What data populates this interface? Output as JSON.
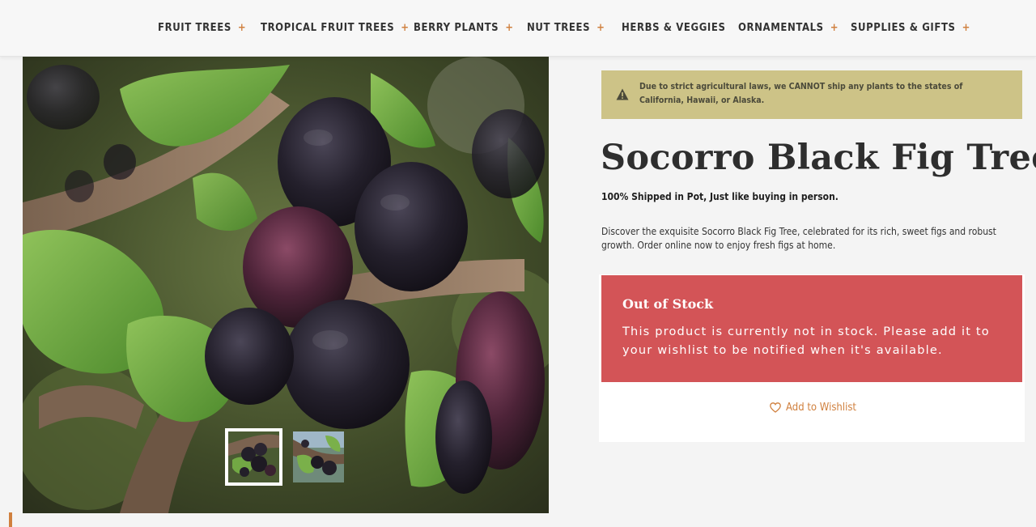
{
  "nav": {
    "items": [
      {
        "label": "FRUIT TREES",
        "has_submenu": true
      },
      {
        "label": "TROPICAL FRUIT TREES",
        "has_submenu": true
      },
      {
        "label": "BERRY PLANTS",
        "has_submenu": true
      },
      {
        "label": "NUT TREES",
        "has_submenu": true
      },
      {
        "label": "HERBS & VEGGIES",
        "has_submenu": false
      },
      {
        "label": "ORNAMENTALS",
        "has_submenu": true
      },
      {
        "label": "SUPPLIES & GIFTS",
        "has_submenu": true
      }
    ],
    "submenu_symbol": "+"
  },
  "notice": {
    "icon": "warning-icon",
    "text": "Due to strict agricultural laws, we CANNOT ship any plants to the states of California, Hawaii, or Alaska."
  },
  "product": {
    "title": "Socorro Black Fig Tree",
    "shipped_note": "100% Shipped in Pot, Just like buying in person.",
    "description": "Discover the exquisite Socorro Black Fig Tree, celebrated for its rich, sweet figs and robust growth. Order online now to enjoy fresh figs at home.",
    "image_alt": "Socorro Black Fig Tree",
    "thumbnails": [
      "Thumbnail 1",
      "Thumbnail 2"
    ]
  },
  "stock": {
    "title": "Out of Stock",
    "message": "This product is currently not in stock. Please add it to your wishlist to be notified when it's available.",
    "wishlist_label": "Add to Wishlist",
    "wishlist_icon": "heart-icon"
  },
  "colors": {
    "accent": "#d0803e",
    "notice_bg": "#cdc387",
    "out_of_stock_bg": "#d35457",
    "heading": "#2e2e2e"
  }
}
